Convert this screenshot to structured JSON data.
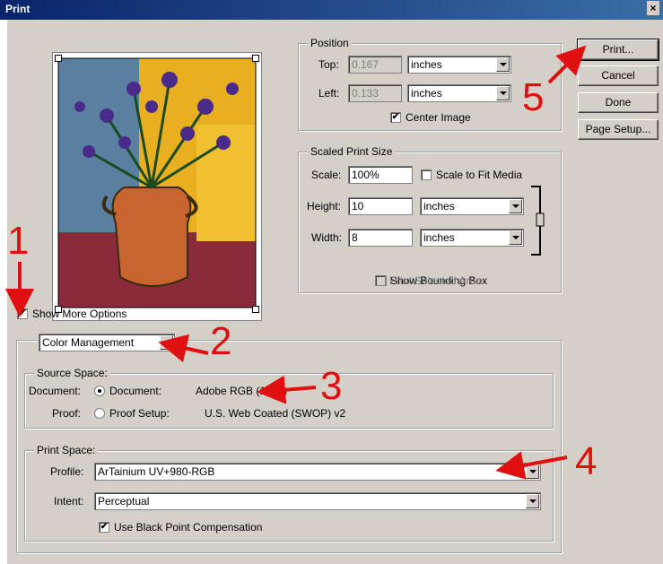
{
  "window": {
    "title": "Print",
    "close": "×"
  },
  "position": {
    "legend": "Position",
    "top_label": "Top:",
    "top_value": "0.167",
    "top_unit": "inches",
    "left_label": "Left:",
    "left_value": "0.133",
    "left_unit": "inches",
    "center_image": "Center Image",
    "center_image_checked": true
  },
  "scaled": {
    "legend": "Scaled Print Size",
    "scale_label": "Scale:",
    "scale_value": "100%",
    "fit_media": "Scale to Fit Media",
    "height_label": "Height:",
    "height_value": "10",
    "height_unit": "inches",
    "width_label": "Width:",
    "width_value": "8",
    "width_unit": "inches",
    "show_bbox": "Show Bounding Box",
    "print_selected": "Print Selected Area"
  },
  "buttons": {
    "print": "Print...",
    "cancel": "Cancel",
    "done": "Done",
    "page_setup": "Page Setup..."
  },
  "more_options": "Show More Options",
  "color_mgmt": {
    "select": "Color Management",
    "source_legend": "Source Space:",
    "doc_label": "Document:",
    "doc_option": "Document:",
    "doc_value": "Adobe RGB (1998)",
    "proof_label": "Proof:",
    "proof_option": "Proof Setup:",
    "proof_value": "U.S. Web Coated (SWOP) v2",
    "print_legend": "Print Space:",
    "profile_label": "Profile:",
    "profile_value": "ArTainium UV+980-RGB",
    "intent_label": "Intent:",
    "intent_value": "Perceptual",
    "bpc": "Use Black Point Compensation"
  },
  "annotations": {
    "n1": "1",
    "n2": "2",
    "n3": "3",
    "n4": "4",
    "n5": "5"
  },
  "colors": {
    "annotation": "#e01010",
    "dialog": "#d4d0c8",
    "titlebar": "#0a246a"
  },
  "check_mark": "✔"
}
